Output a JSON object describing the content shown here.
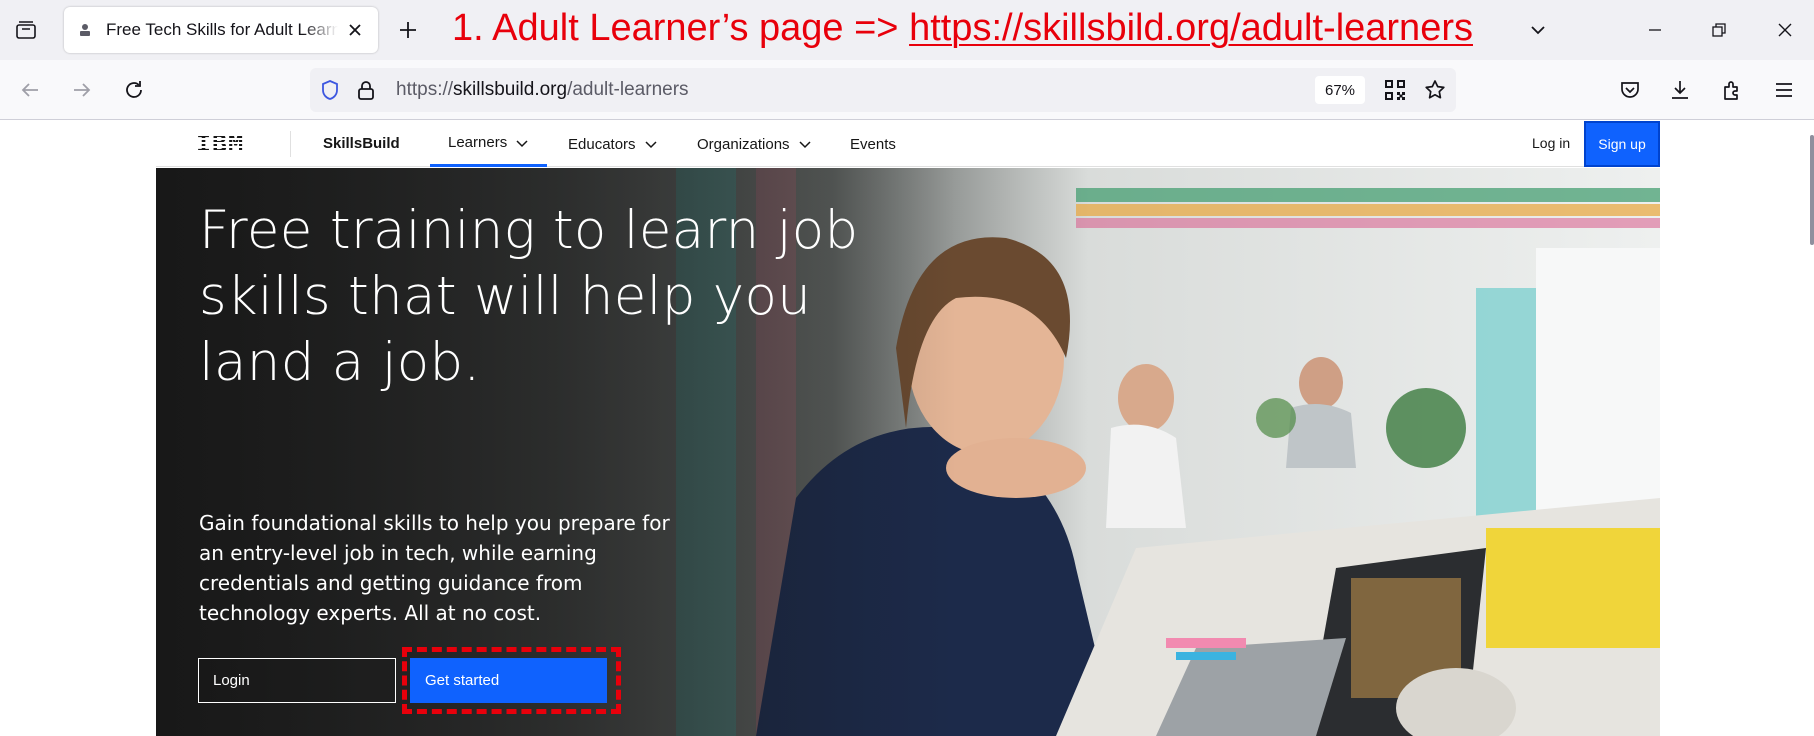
{
  "browser": {
    "tab": {
      "title": "Free Tech Skills for Adult Learners | IBM SkillsBuild"
    },
    "annotation": {
      "prefix": "1. Adult Learner’s page => ",
      "url": "https://skillsbild.org/adult-learners"
    },
    "address": {
      "scheme": "https://",
      "host": "skillsbuild.org",
      "path": "/adult-learners",
      "zoom": "67%"
    },
    "icons": [
      "tab-list-icon",
      "favicon-icon",
      "close-tab-icon",
      "new-tab-icon",
      "list-all-tabs-icon",
      "minimize-icon",
      "restore-icon",
      "close-window-icon",
      "back-icon",
      "forward-icon",
      "reload-icon",
      "tracking-shield-icon",
      "lock-icon",
      "qr-code-icon",
      "bookmark-star-icon",
      "pocket-icon",
      "downloads-icon",
      "extensions-icon",
      "menu-icon"
    ]
  },
  "site": {
    "logo": "IBM",
    "brand": "SkillsBuild",
    "menu": [
      {
        "label": "Learners",
        "active": true
      },
      {
        "label": "Educators",
        "active": false
      },
      {
        "label": "Organizations",
        "active": false
      },
      {
        "label": "Events",
        "active": false
      }
    ],
    "login_link": "Log in",
    "signup_button": "Sign up"
  },
  "hero": {
    "title": "Free training to learn job skills that will help you land a job.",
    "subtitle": "Gain foundational skills to help you prepare for an entry-level job in tech, while earning credentials and getting guidance from technology experts. All at no cost.",
    "login_button": "Login",
    "start_button": "Get started"
  },
  "colors": {
    "accent": "#0f62fe",
    "annotation": "#e8000b",
    "hero_overlay": "#161616"
  }
}
